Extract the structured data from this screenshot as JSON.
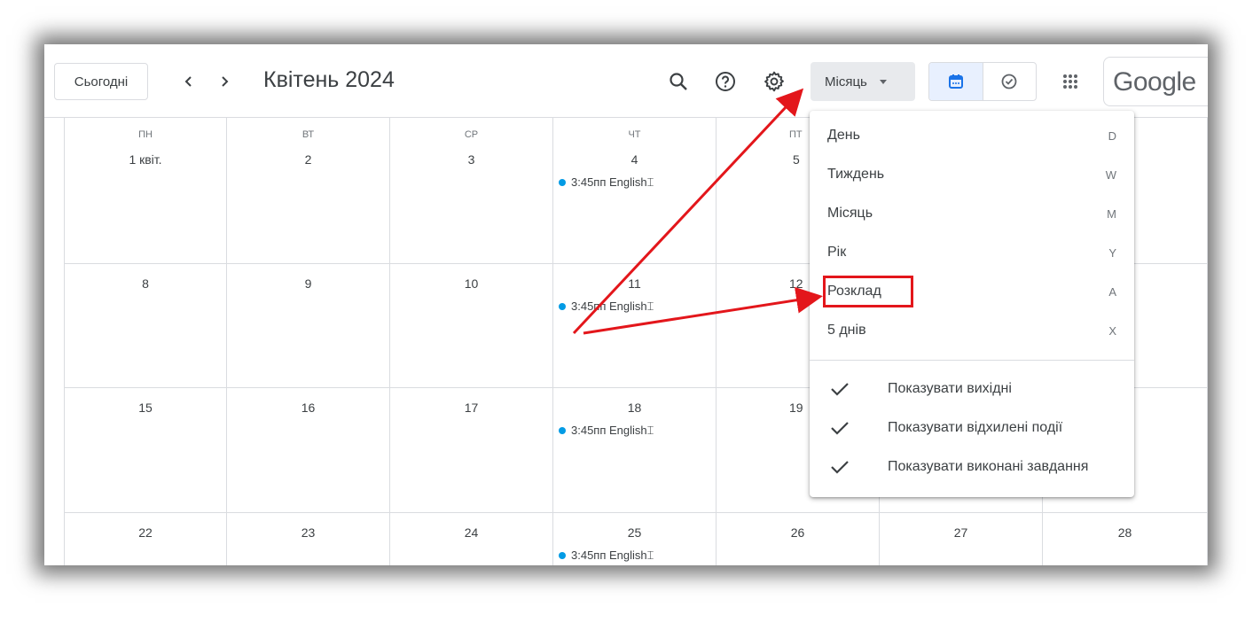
{
  "toolbar": {
    "today_label": "Сьогодні",
    "title": "Квітень 2024",
    "view_label": "Місяць",
    "google_text": "Google",
    "icons": [
      "chevron-left-icon",
      "chevron-right-icon",
      "search-icon",
      "help-icon",
      "gear-icon",
      "calendar-icon",
      "tasks-icon",
      "apps-grid-icon"
    ]
  },
  "calendar": {
    "days_of_week": [
      "ПН",
      "ВТ",
      "СР",
      "ЧТ",
      "ПТ"
    ],
    "rows": [
      [
        "1 квіт.",
        "2",
        "3",
        "4",
        "5"
      ],
      [
        "8",
        "9",
        "10",
        "11",
        "12"
      ],
      [
        "15",
        "16",
        "17",
        "18",
        "19"
      ],
      [
        "22",
        "23",
        "24",
        "25",
        "26",
        "27",
        "28"
      ]
    ],
    "event_label": "3:45пп English⌶"
  },
  "view_menu": {
    "items": [
      {
        "label": "День",
        "shortcut": "D"
      },
      {
        "label": "Тиждень",
        "shortcut": "W"
      },
      {
        "label": "Місяць",
        "shortcut": "M"
      },
      {
        "label": "Рік",
        "shortcut": "Y"
      },
      {
        "label": "Розклад",
        "shortcut": "A"
      },
      {
        "label": "5 днів",
        "shortcut": "X"
      }
    ],
    "options": [
      {
        "label": "Показувати вихідні",
        "checked": true
      },
      {
        "label": "Показувати відхилені події",
        "checked": true
      },
      {
        "label": "Показувати виконані завдання",
        "checked": true
      }
    ]
  },
  "colors": {
    "event_dot": "#039be5",
    "annotation": "#e3161b",
    "accent": "#1a73e8"
  }
}
